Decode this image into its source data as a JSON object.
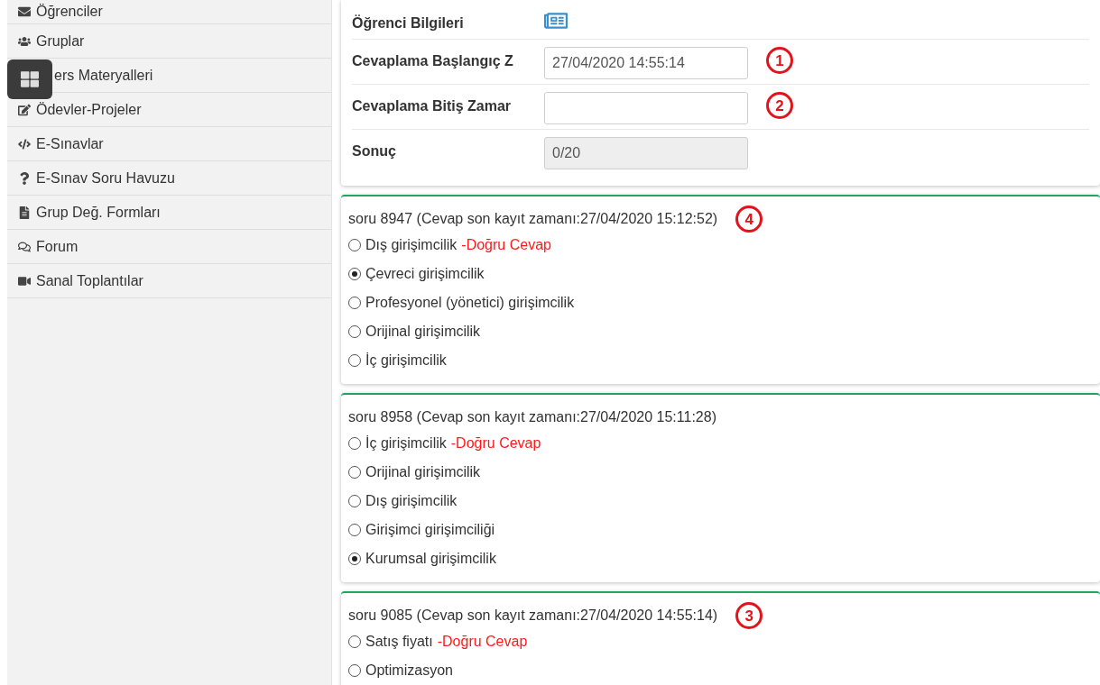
{
  "sidebar": {
    "items": [
      {
        "label": "Öğrenciler"
      },
      {
        "label": "Gruplar"
      },
      {
        "label": "ers Materyalleri"
      },
      {
        "label": "Ödevler-Projeler"
      },
      {
        "label": "E-Sınavlar"
      },
      {
        "label": "E-Sınav Soru Havuzu"
      },
      {
        "label": "Grup Değ. Formları"
      },
      {
        "label": "Forum"
      },
      {
        "label": "Sanal Toplantılar"
      }
    ]
  },
  "info": {
    "rows": [
      {
        "kind": "link",
        "label": "Öğrenci Bilgileri"
      },
      {
        "kind": "input",
        "label": "Cevaplama Başlangıç Z",
        "value": "27/04/2020 14:55:14",
        "marker": "1"
      },
      {
        "kind": "input",
        "label": "Cevaplama Bitiş Zamar",
        "value": "",
        "marker": "2"
      },
      {
        "kind": "readonly",
        "label": "Sonuç",
        "value": "0/20"
      }
    ]
  },
  "questions": [
    {
      "title": "soru 8947 (Cevap son kayıt zamanı:27/04/2020 15:12:52)",
      "marker": "4",
      "options": [
        {
          "text": "Dış girişimcilik",
          "note": "-Doğru Cevap",
          "selected": false
        },
        {
          "text": "Çevreci girişimcilik",
          "selected": true
        },
        {
          "text": "Profesyonel (yönetici) girişimcilik",
          "selected": false
        },
        {
          "text": "Orijinal girişimcilik",
          "selected": false
        },
        {
          "text": "İç girişimcilik",
          "selected": false
        }
      ]
    },
    {
      "title": "soru 8958 (Cevap son kayıt zamanı:27/04/2020 15:11:28)",
      "options": [
        {
          "text": "İç girişimcilik",
          "note": "-Doğru Cevap",
          "selected": false
        },
        {
          "text": "Orijinal girişimcilik",
          "selected": false
        },
        {
          "text": "Dış girişimcilik",
          "selected": false
        },
        {
          "text": "Girişimci girişimciliği",
          "selected": false
        },
        {
          "text": "Kurumsal girişimcilik",
          "selected": true
        }
      ]
    },
    {
      "title": "soru 9085 (Cevap son kayıt zamanı:27/04/2020 14:55:14)",
      "marker": "3",
      "options": [
        {
          "text": "Satış fiyatı",
          "note": "-Doğru Cevap",
          "selected": false
        },
        {
          "text": "Optimizasyon",
          "selected": false
        }
      ]
    }
  ]
}
